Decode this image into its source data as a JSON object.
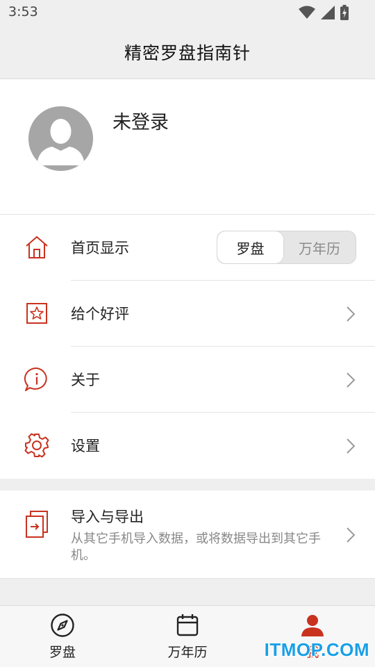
{
  "status": {
    "time": "3:53",
    "icons": [
      "wifi-icon",
      "signal-icon",
      "battery-icon"
    ]
  },
  "app_bar": {
    "title": "精密罗盘指南针"
  },
  "profile": {
    "login_text": "未登录",
    "avatar_icon": "person-avatar-icon"
  },
  "menu": {
    "home_display": {
      "label": "首页显示",
      "icon": "home-icon",
      "options": [
        "罗盘",
        "万年历"
      ],
      "selected": "罗盘"
    },
    "rate": {
      "label": "给个好评",
      "icon": "star-icon"
    },
    "about": {
      "label": "关于",
      "icon": "info-icon"
    },
    "settings": {
      "label": "设置",
      "icon": "gear-icon"
    }
  },
  "import_export": {
    "title": "导入与导出",
    "description": "从其它手机导入数据，或将数据导出到其它手机。",
    "icon": "import-icon"
  },
  "bottom_nav": {
    "items": [
      {
        "label": "罗盘",
        "icon": "compass-icon"
      },
      {
        "label": "万年历",
        "icon": "calendar-icon"
      },
      {
        "label": "我",
        "icon": "person-icon"
      }
    ],
    "active_index": 2
  },
  "watermark": {
    "text": "ITMOP.COM"
  },
  "colors": {
    "accent": "#c8321f",
    "background": "#efefef",
    "surface": "#ffffff",
    "secondary_text": "#888888",
    "watermark": "#1aa0e6"
  }
}
